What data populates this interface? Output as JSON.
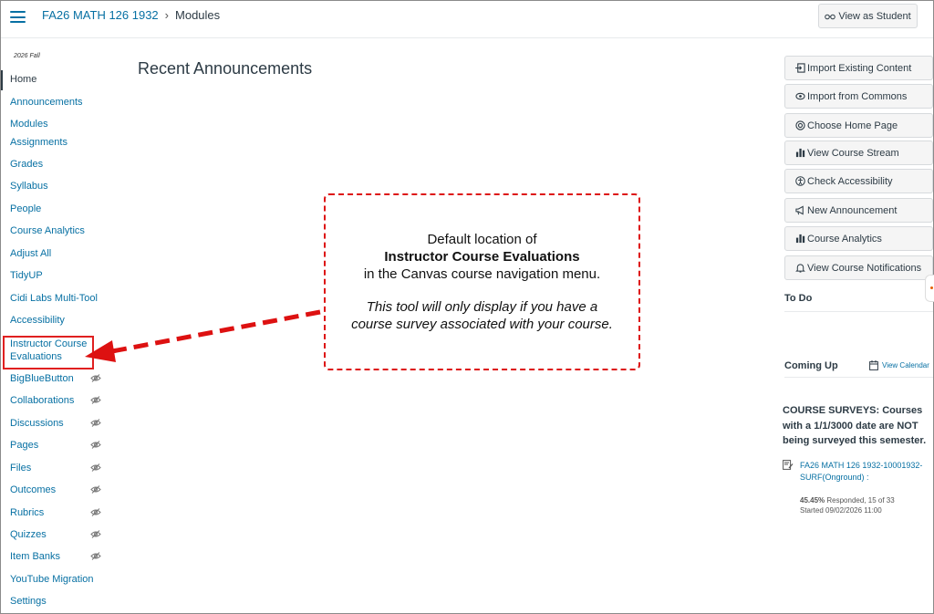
{
  "header": {
    "breadcrumb_course": "FA26 MATH 126 1932",
    "breadcrumb_separator": "›",
    "breadcrumb_page": "Modules",
    "view_as_student": "View as Student"
  },
  "sidebar": {
    "term": "2026 Fall",
    "items": [
      {
        "label": "Home",
        "active": true,
        "hidden": false
      },
      {
        "label": "Announcements",
        "hidden": false
      },
      {
        "label": "Modules",
        "hidden": false
      },
      {
        "label": "Assignments",
        "hidden": false
      },
      {
        "label": "Grades",
        "hidden": false
      },
      {
        "label": "Syllabus",
        "hidden": false
      },
      {
        "label": "People",
        "hidden": false
      },
      {
        "label": "Course Analytics",
        "hidden": false
      },
      {
        "label": "Adjust All",
        "hidden": false
      },
      {
        "label": "TidyUP",
        "hidden": false
      },
      {
        "label": "Cidi Labs Multi-Tool",
        "hidden": false
      },
      {
        "label": "Accessibility",
        "hidden": false
      },
      {
        "label": "Instructor Course Evaluations",
        "hidden": false,
        "highlighted": true
      },
      {
        "label": "BigBlueButton",
        "hidden": true
      },
      {
        "label": "Collaborations",
        "hidden": true
      },
      {
        "label": "Discussions",
        "hidden": true
      },
      {
        "label": "Pages",
        "hidden": true
      },
      {
        "label": "Files",
        "hidden": true
      },
      {
        "label": "Outcomes",
        "hidden": true
      },
      {
        "label": "Rubrics",
        "hidden": true
      },
      {
        "label": "Quizzes",
        "hidden": true
      },
      {
        "label": "Item Banks",
        "hidden": true
      },
      {
        "label": "YouTube Migration",
        "hidden": false
      },
      {
        "label": "Settings",
        "hidden": false
      }
    ]
  },
  "main": {
    "title": "Recent Announcements"
  },
  "callout": {
    "line1": "Default location of",
    "line2": "Instructor Course Evaluations",
    "line3": "in the Canvas course navigation menu.",
    "line4": "This tool will only display if you have a",
    "line5": "course survey associated with your course.",
    "color": "#dd1111"
  },
  "right_sidebar": {
    "buttons": [
      {
        "label": "Import Existing Content",
        "icon": "import-icon"
      },
      {
        "label": "Import from Commons",
        "icon": "commons-icon"
      },
      {
        "label": "Choose Home Page",
        "icon": "target-icon"
      },
      {
        "label": "View Course Stream",
        "icon": "bar-chart-icon"
      },
      {
        "label": "Check Accessibility",
        "icon": "accessibility-icon"
      },
      {
        "label": "New Announcement",
        "icon": "megaphone-icon"
      },
      {
        "label": "Course Analytics",
        "icon": "bar-chart-icon"
      },
      {
        "label": "View Course Notifications",
        "icon": "bell-icon"
      }
    ],
    "todo_heading": "To Do",
    "coming_up_heading": "Coming Up",
    "view_calendar": "View Calendar",
    "surveys_notice": "COURSE SURVEYS: Courses with a 1/1/3000 date are NOT being surveyed this semester.",
    "survey_link": "FA26 MATH 126 1932-10001932-SURF(Onground) :",
    "survey_percent": "45.45%",
    "survey_responded": "Responded, 15 of 33",
    "survey_started": "Started 09/02/2026 11:00"
  },
  "colors": {
    "link": "#0770a3",
    "text": "#2d3b45",
    "highlight_box": "#e02020"
  }
}
